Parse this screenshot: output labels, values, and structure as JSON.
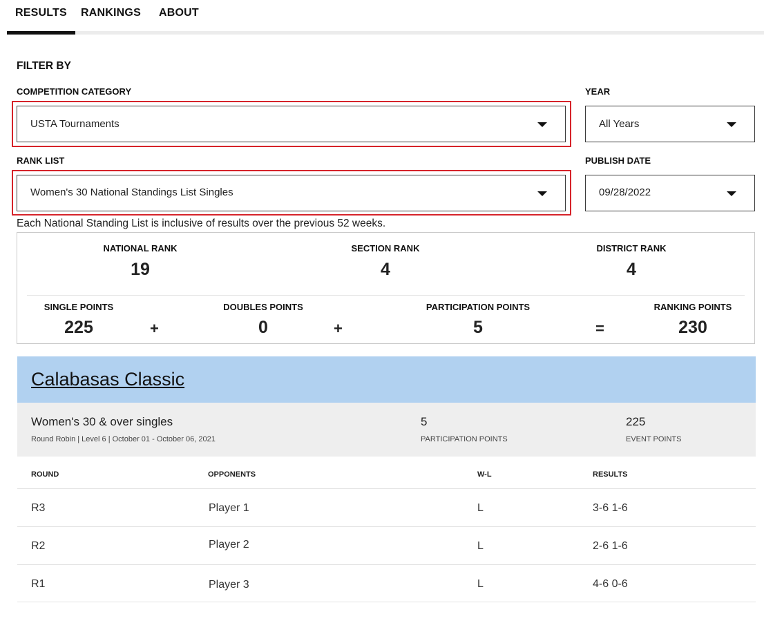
{
  "tabs": [
    {
      "label": "RESULTS",
      "active": true
    },
    {
      "label": "RANKINGS",
      "active": false
    },
    {
      "label": "ABOUT",
      "active": false
    }
  ],
  "filters": {
    "title": "FILTER BY",
    "competition_category": {
      "label": "COMPETITION CATEGORY",
      "value": "USTA Tournaments"
    },
    "year": {
      "label": "YEAR",
      "value": "All Years"
    },
    "rank_list": {
      "label": "RANK LIST",
      "value": "Women's 30 National Standings List Singles"
    },
    "publish_date": {
      "label": "PUBLISH DATE",
      "value": "09/28/2022"
    },
    "highlight_color": "#d6232a"
  },
  "note": "Each National Standing List is inclusive of results over the previous 52 weeks.",
  "ranks": {
    "national": {
      "label": "NATIONAL RANK",
      "value": "19"
    },
    "section": {
      "label": "SECTION RANK",
      "value": "4"
    },
    "district": {
      "label": "DISTRICT RANK",
      "value": "4"
    }
  },
  "points": {
    "single": {
      "label": "SINGLE POINTS",
      "value": "225"
    },
    "doubles": {
      "label": "DOUBLES POINTS",
      "value": "0"
    },
    "participation": {
      "label": "PARTICIPATION POINTS",
      "value": "5"
    },
    "ranking": {
      "label": "RANKING POINTS",
      "value": "230"
    },
    "op_plus": "+",
    "op_equals": "="
  },
  "event": {
    "title": "Calabasas Classic",
    "header_color": "#b1d1f0",
    "division": "Women's 30 & over singles",
    "details": "Round Robin | Level 6 | October 01 - October 06, 2021",
    "participation_points": {
      "value": "5",
      "label": "PARTICIPATION POINTS"
    },
    "event_points": {
      "value": "225",
      "label": "EVENT POINTS"
    }
  },
  "matches": {
    "columns": [
      "ROUND",
      "OPPONENTS",
      "W-L",
      "RESULTS"
    ],
    "rows": [
      {
        "round": "R3",
        "opponent": "Player 1",
        "wl": "L",
        "result": "3-6 1-6"
      },
      {
        "round": "R2",
        "opponent": "Player 2",
        "wl": "L",
        "result": "2-6 1-6"
      },
      {
        "round": "R1",
        "opponent": "Player 3",
        "wl": "L",
        "result": "4-6 0-6"
      }
    ]
  }
}
